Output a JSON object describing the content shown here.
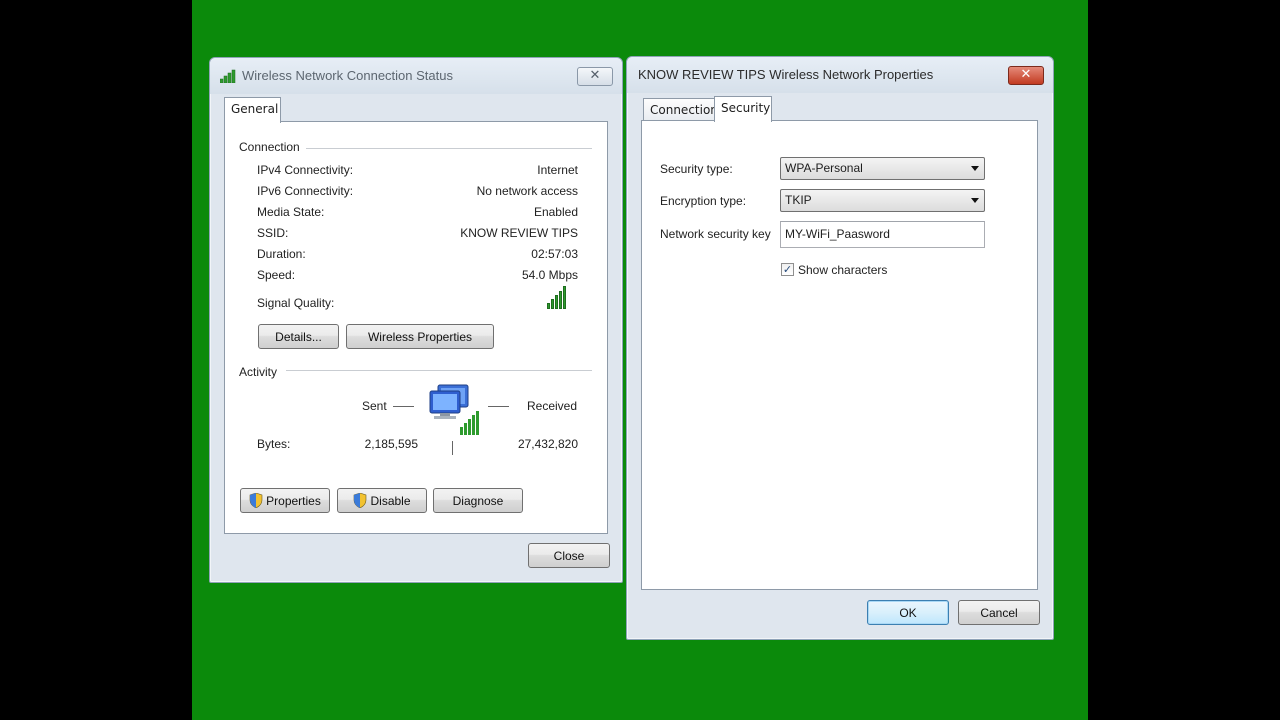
{
  "status_dialog": {
    "title": "Wireless Network Connection Status",
    "close_glyph": "✕",
    "tab": "General",
    "connection_header": "Connection",
    "rows": [
      {
        "label": "IPv4 Connectivity:",
        "value": "Internet"
      },
      {
        "label": "IPv6 Connectivity:",
        "value": "No network access"
      },
      {
        "label": "Media State:",
        "value": "Enabled"
      },
      {
        "label": "SSID:",
        "value": "KNOW REVIEW TIPS"
      },
      {
        "label": "Duration:",
        "value": "02:57:03"
      },
      {
        "label": "Speed:",
        "value": "54.0 Mbps"
      }
    ],
    "signal_label": "Signal Quality:",
    "details_button": "Details...",
    "wireless_properties_button": "Wireless Properties",
    "activity_header": "Activity",
    "sent_label": "Sent",
    "received_label": "Received",
    "bytes_label": "Bytes:",
    "bytes_sent": "2,185,595",
    "bytes_received": "27,432,820",
    "properties_button": "Properties",
    "disable_button": "Disable",
    "diagnose_button": "Diagnose",
    "close_button": "Close"
  },
  "properties_dialog": {
    "title": "KNOW REVIEW TIPS Wireless Network Properties",
    "close_glyph": "✕",
    "tabs": [
      "Connection",
      "Security"
    ],
    "active_tab": "Security",
    "security_type_label": "Security type:",
    "security_type_value": "WPA-Personal",
    "encryption_type_label": "Encryption type:",
    "encryption_type_value": "TKIP",
    "network_key_label": "Network security key",
    "network_key_value": "MY-WiFi_Paasword",
    "show_characters_label": "Show characters",
    "show_characters_checked": true,
    "check_glyph": "✓",
    "ok_button": "OK",
    "cancel_button": "Cancel"
  },
  "colors": {
    "desktop_background": "#0b8a0b",
    "signal_bars": "#2e9b2e"
  }
}
